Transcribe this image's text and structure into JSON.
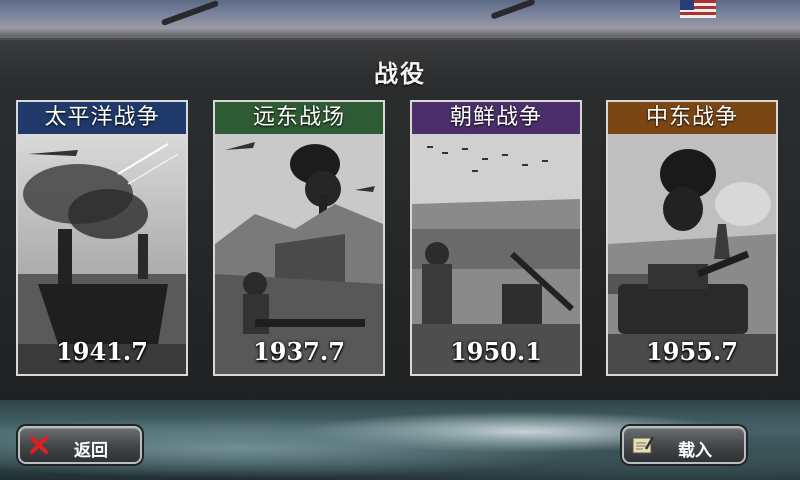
{
  "screen": {
    "title": "战役"
  },
  "campaigns": [
    {
      "name": "太平洋战争",
      "date": "1941.7",
      "header_color": "#1f3a6a",
      "scene": "aircraft-carrier-battle"
    },
    {
      "name": "远东战场",
      "date": "1937.7",
      "header_color": "#2e5a34",
      "scene": "great-wall-battle"
    },
    {
      "name": "朝鲜战争",
      "date": "1950.1",
      "header_color": "#4a2f6a",
      "scene": "artillery-battle"
    },
    {
      "name": "中东战争",
      "date": "1955.7",
      "header_color": "#7a4614",
      "scene": "tank-oilfield-battle"
    }
  ],
  "buttons": {
    "back": {
      "label": "返回",
      "icon": "red-x-icon"
    },
    "load": {
      "label": "载入",
      "icon": "note-pencil-icon"
    }
  }
}
